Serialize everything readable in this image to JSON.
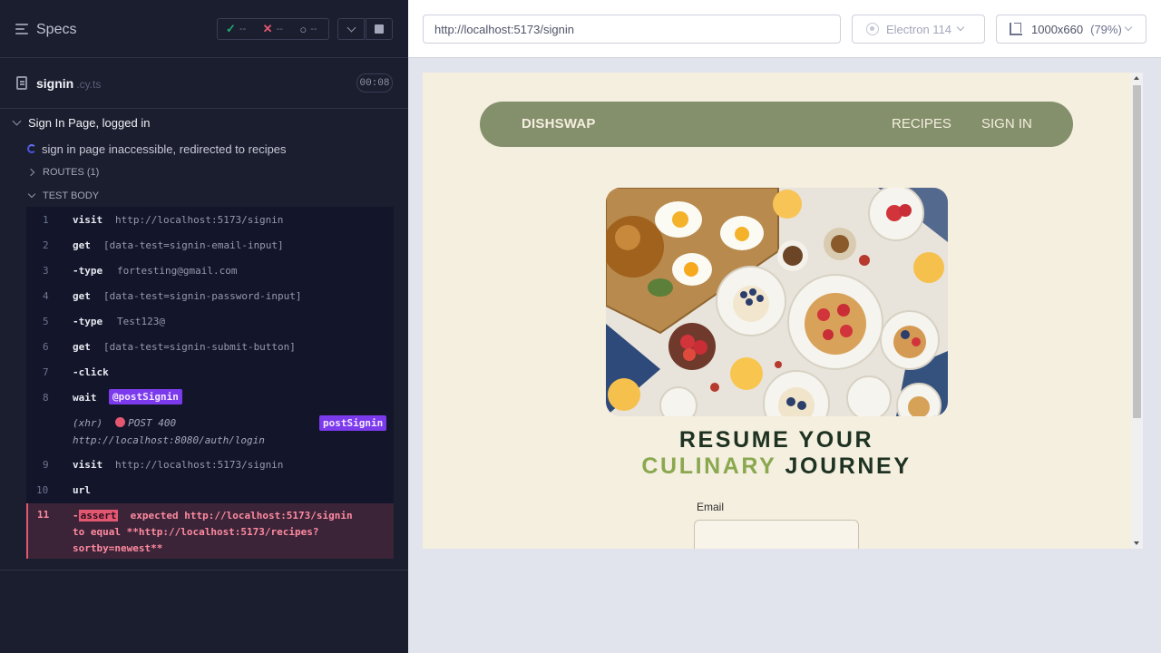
{
  "runner": {
    "specs_label": "Specs",
    "stats": {
      "passed": "--",
      "failed": "--",
      "pending": "--"
    },
    "spec_file": {
      "name": "signin",
      "ext": ".cy.ts",
      "duration": "00:08"
    },
    "suite_title": "Sign In Page, logged in",
    "test_title": "sign in page inaccessible, redirected to recipes",
    "routes_label": "ROUTES (1)",
    "test_body_label": "TEST BODY",
    "commands": [
      {
        "num": "1",
        "name": "visit",
        "message": "http://localhost:5173/signin"
      },
      {
        "num": "2",
        "name": "get",
        "message": "[data-test=signin-email-input]"
      },
      {
        "num": "3",
        "name": "-type",
        "message": "fortesting@gmail.com"
      },
      {
        "num": "4",
        "name": "get",
        "message": "[data-test=signin-password-input]"
      },
      {
        "num": "5",
        "name": "-type",
        "message": "Test123@"
      },
      {
        "num": "6",
        "name": "get",
        "message": "[data-test=signin-submit-button]"
      },
      {
        "num": "7",
        "name": "-click",
        "message": ""
      },
      {
        "num": "8",
        "name": "wait",
        "message": "@postSignin"
      },
      {
        "num": "9",
        "name": "visit",
        "message": "http://localhost:5173/signin"
      },
      {
        "num": "10",
        "name": "url",
        "message": ""
      }
    ],
    "xhr": {
      "type": "(xhr)",
      "status": "POST 400",
      "url": "http://localhost:8080/auth/login",
      "alias": "postSignin"
    },
    "error": {
      "num": "11",
      "dash": "-",
      "tag": "assert",
      "line1": "expected http://localhost:5173/signin",
      "line2": "to equal **http://localhost:5173/recipes?",
      "line3": "sortby=newest**"
    }
  },
  "browser": {
    "url": "http://localhost:5173/signin",
    "browser_name": "Electron 114",
    "viewport": "1000x660",
    "zoom": "(79%)"
  },
  "app": {
    "brand": "DISHSWAP",
    "nav": {
      "recipes": "RECIPES",
      "signin": "SIGN IN"
    },
    "headline_line1": "RESUME YOUR",
    "headline_accent": "CULINARY",
    "headline_rest": "JOURNEY",
    "email_label": "Email",
    "colors": {
      "nav_bg": "#848f6c",
      "page_bg": "#f5efdf",
      "accent": "#8aa850",
      "heading": "#1e3222"
    }
  }
}
